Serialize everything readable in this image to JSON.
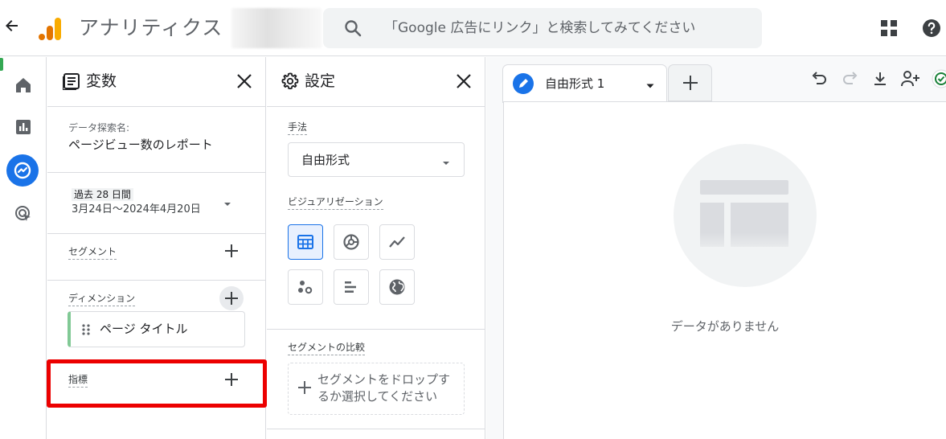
{
  "app": {
    "title": "アナリティクス",
    "search_placeholder": "「Google 広告にリンク」と検索してみてください"
  },
  "variables_panel": {
    "title": "変数",
    "exploration_name_label": "データ探索名:",
    "exploration_name": "ページビュー数のレポート",
    "date_chip": "過去 28 日間",
    "date_range": "3月24日～2024年4月20日",
    "segment_label": "セグメント",
    "dimension_label": "ディメンション",
    "dimension_item": "ページ タイトル",
    "metrics_label": "指標"
  },
  "settings_panel": {
    "title": "設定",
    "technique_label": "手法",
    "technique_value": "自由形式",
    "visualization_label": "ビジュアリゼーション",
    "visualization_options": [
      "table-icon",
      "donut-chart-icon",
      "line-chart-icon",
      "scatter-icon",
      "bar-chart-icon",
      "geo-map-icon"
    ],
    "segment_compare_label": "セグメントの比較",
    "segment_drop_text": "セグメントをドロップするか選択してください"
  },
  "canvas": {
    "tab_label": "自由形式 1",
    "empty_text": "データがありません"
  },
  "colors": {
    "accent": "#1a73e8",
    "highlight": "#ec0000",
    "dimension_chip": "#81c995"
  }
}
